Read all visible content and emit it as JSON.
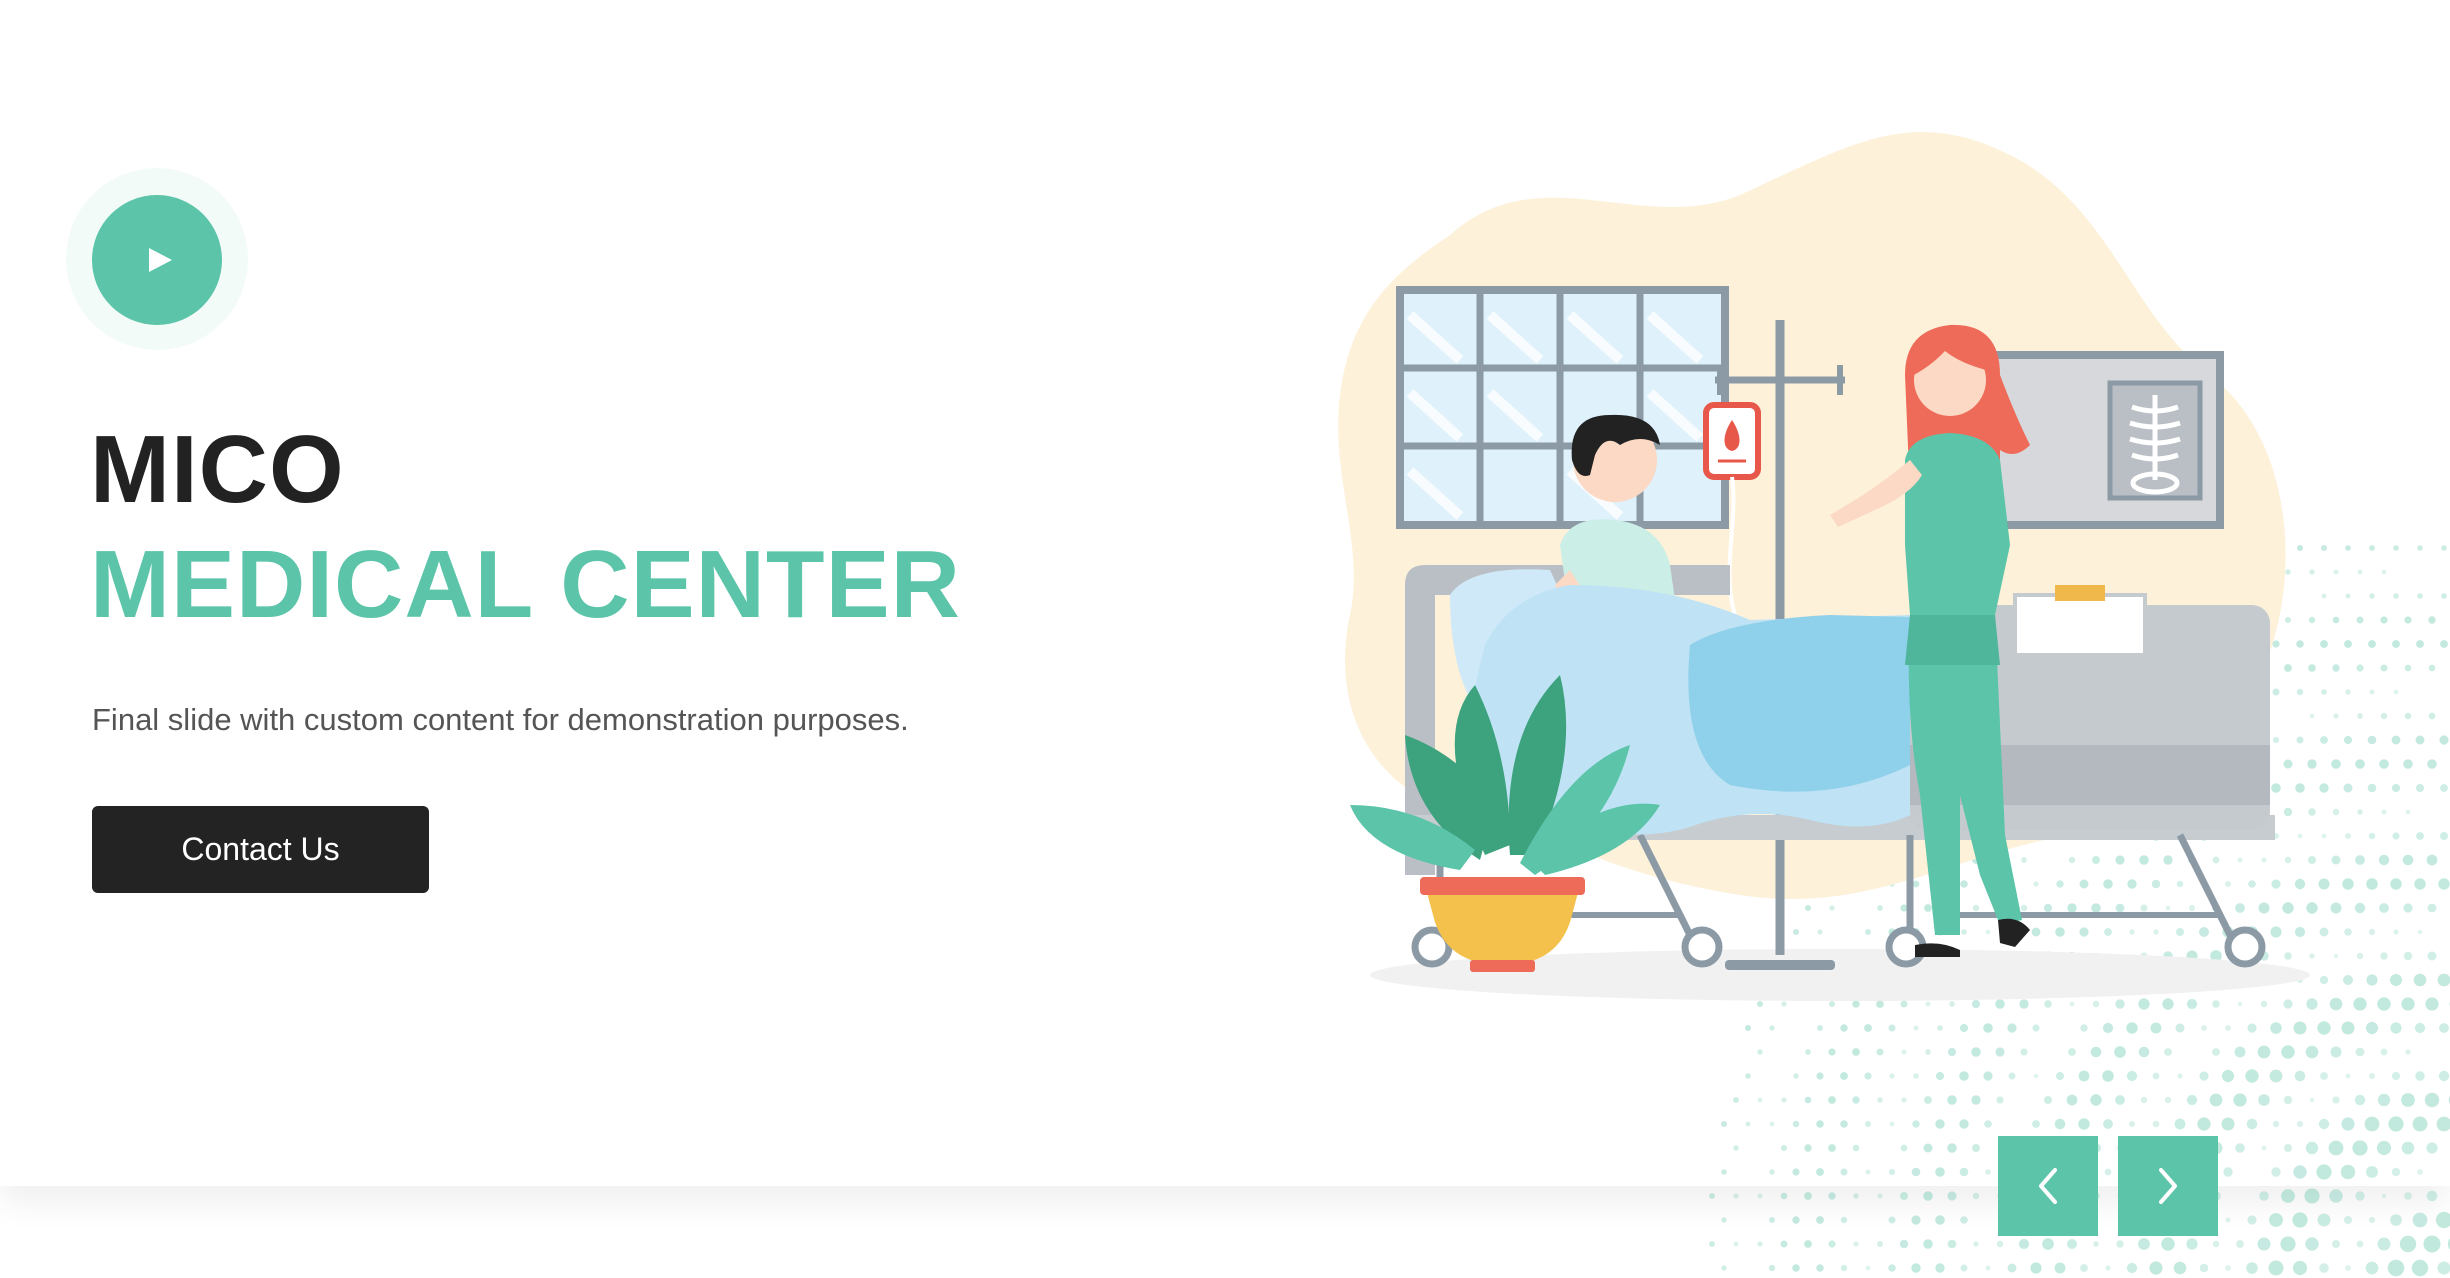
{
  "hero": {
    "title_line1": "MICO",
    "title_line2": "MEDICAL CENTER",
    "subtitle": "Final slide with custom content for demonstration purposes.",
    "cta_label": "Contact Us"
  },
  "icons": {
    "play": "play-icon",
    "prev": "chevron-left-icon",
    "next": "chevron-right-icon"
  },
  "colors": {
    "accent": "#5bc4a9",
    "dark": "#232323",
    "text": "#555555",
    "blob": "#fdf1d9"
  }
}
